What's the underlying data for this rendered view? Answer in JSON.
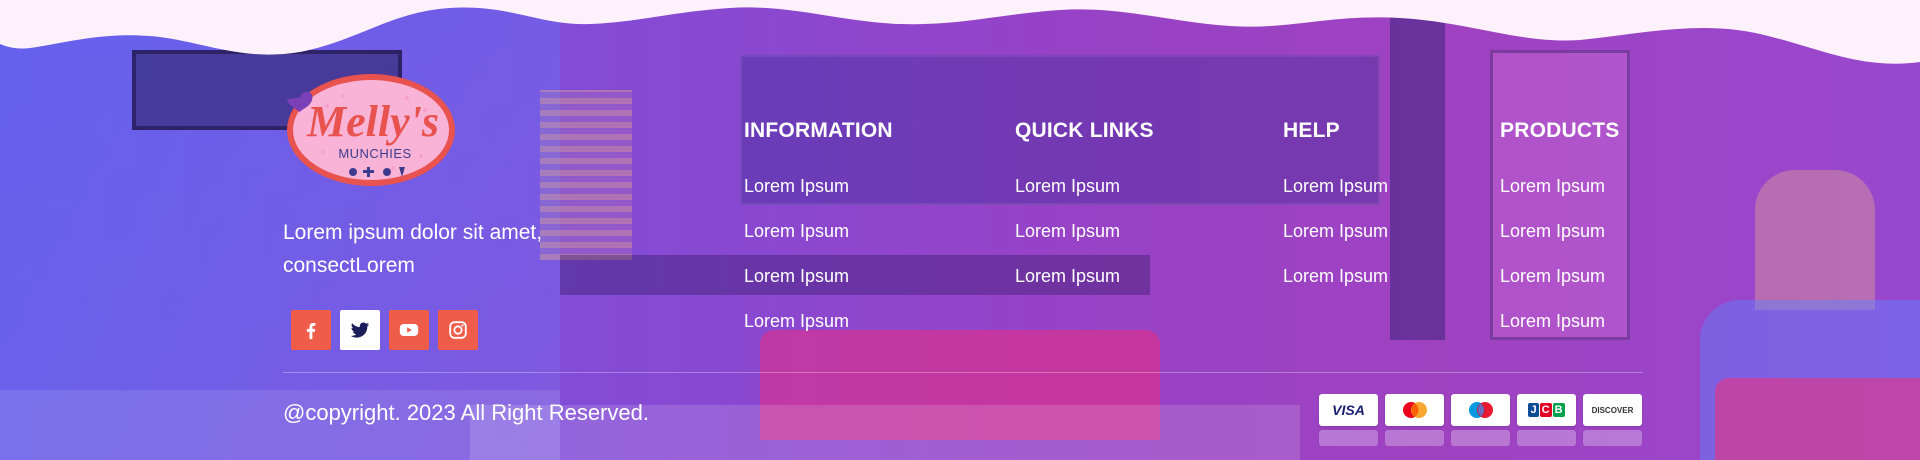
{
  "colors": {
    "overlay_left": "#6856e8",
    "overlay_right": "#bc3ab4",
    "wave_fill": "#fdf1fc",
    "social_bg": "#ef5c4a",
    "social_active_bg": "#ffffff",
    "logo_oval": "#f9b3d6",
    "logo_border": "#e8524f",
    "logo_text": "#e8524f",
    "logo_sub_text": "#3d3b8e",
    "text": "#ffffff"
  },
  "brand": {
    "logo_alt": "Melly's",
    "logo_icon": "mellys-munchies-logo",
    "about_text": "Lorem ipsum dolor sit amet, consectLorem"
  },
  "social": [
    {
      "icon": "facebook-icon"
    },
    {
      "icon": "twitter-icon"
    },
    {
      "icon": "youtube-icon"
    },
    {
      "icon": "instagram-icon"
    }
  ],
  "columns": [
    {
      "title": "INFORMATION",
      "links": [
        "Lorem Ipsum",
        "Lorem Ipsum",
        "Lorem Ipsum",
        "Lorem Ipsum"
      ]
    },
    {
      "title": "QUICK LINKS",
      "links": [
        "Lorem Ipsum",
        "Lorem Ipsum",
        "Lorem Ipsum"
      ]
    },
    {
      "title": "HELP",
      "links": [
        "Lorem Ipsum",
        "Lorem Ipsum",
        "Lorem Ipsum"
      ]
    },
    {
      "title": "PRODUCTS",
      "links": [
        "Lorem Ipsum",
        "Lorem Ipsum",
        "Lorem Ipsum",
        "Lorem Ipsum"
      ]
    }
  ],
  "copyright": "@copyright. 2023 All Right Reserved.",
  "payments": [
    {
      "icon": "visa-icon",
      "label": "VISA"
    },
    {
      "icon": "mastercard-icon"
    },
    {
      "icon": "maestro-icon"
    },
    {
      "icon": "jcb-icon",
      "label": "JCB"
    },
    {
      "icon": "discover-icon",
      "label": "DISCOVER"
    }
  ]
}
